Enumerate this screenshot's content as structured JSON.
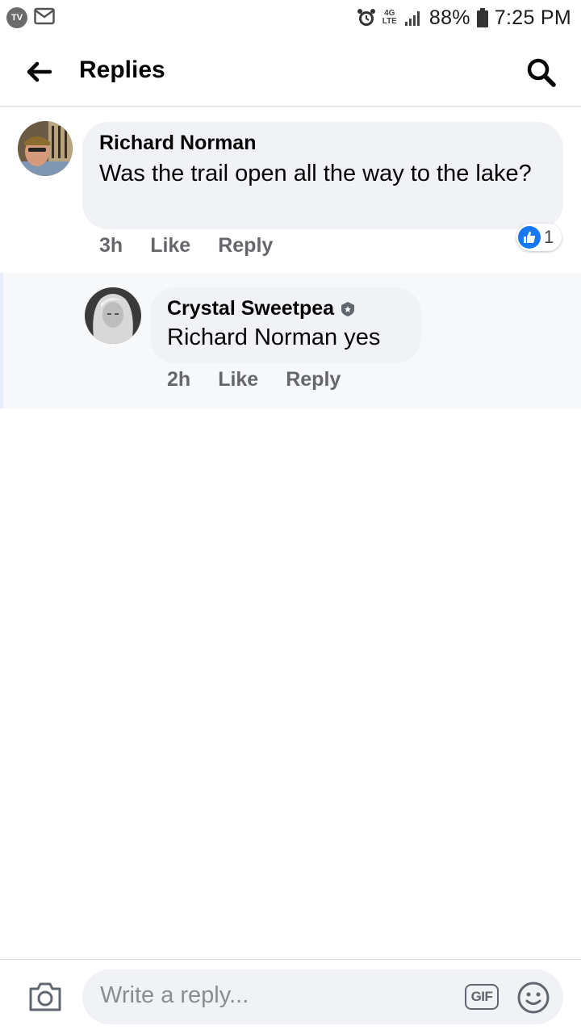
{
  "status_bar": {
    "tv_badge": "TV",
    "network": "4G LTE",
    "battery": "88%",
    "time": "7:25 PM"
  },
  "header": {
    "title": "Replies",
    "back_icon": "arrow-left-icon",
    "search_icon": "search-icon"
  },
  "comment": {
    "author": "Richard Norman",
    "text": "Was the trail open all the way to the lake?",
    "time": "3h",
    "like_label": "Like",
    "reply_label": "Reply",
    "reaction_count": "1"
  },
  "reply": {
    "author": "Crystal Sweetpea",
    "mention": "Richard Norman",
    "text": "yes",
    "time": "2h",
    "like_label": "Like",
    "reply_label": "Reply"
  },
  "composer": {
    "placeholder": "Write a reply...",
    "gif_label": "GIF"
  },
  "colors": {
    "bubble": "#f0f2f5",
    "like_blue": "#1877f2",
    "meta_gray": "#65676b"
  }
}
